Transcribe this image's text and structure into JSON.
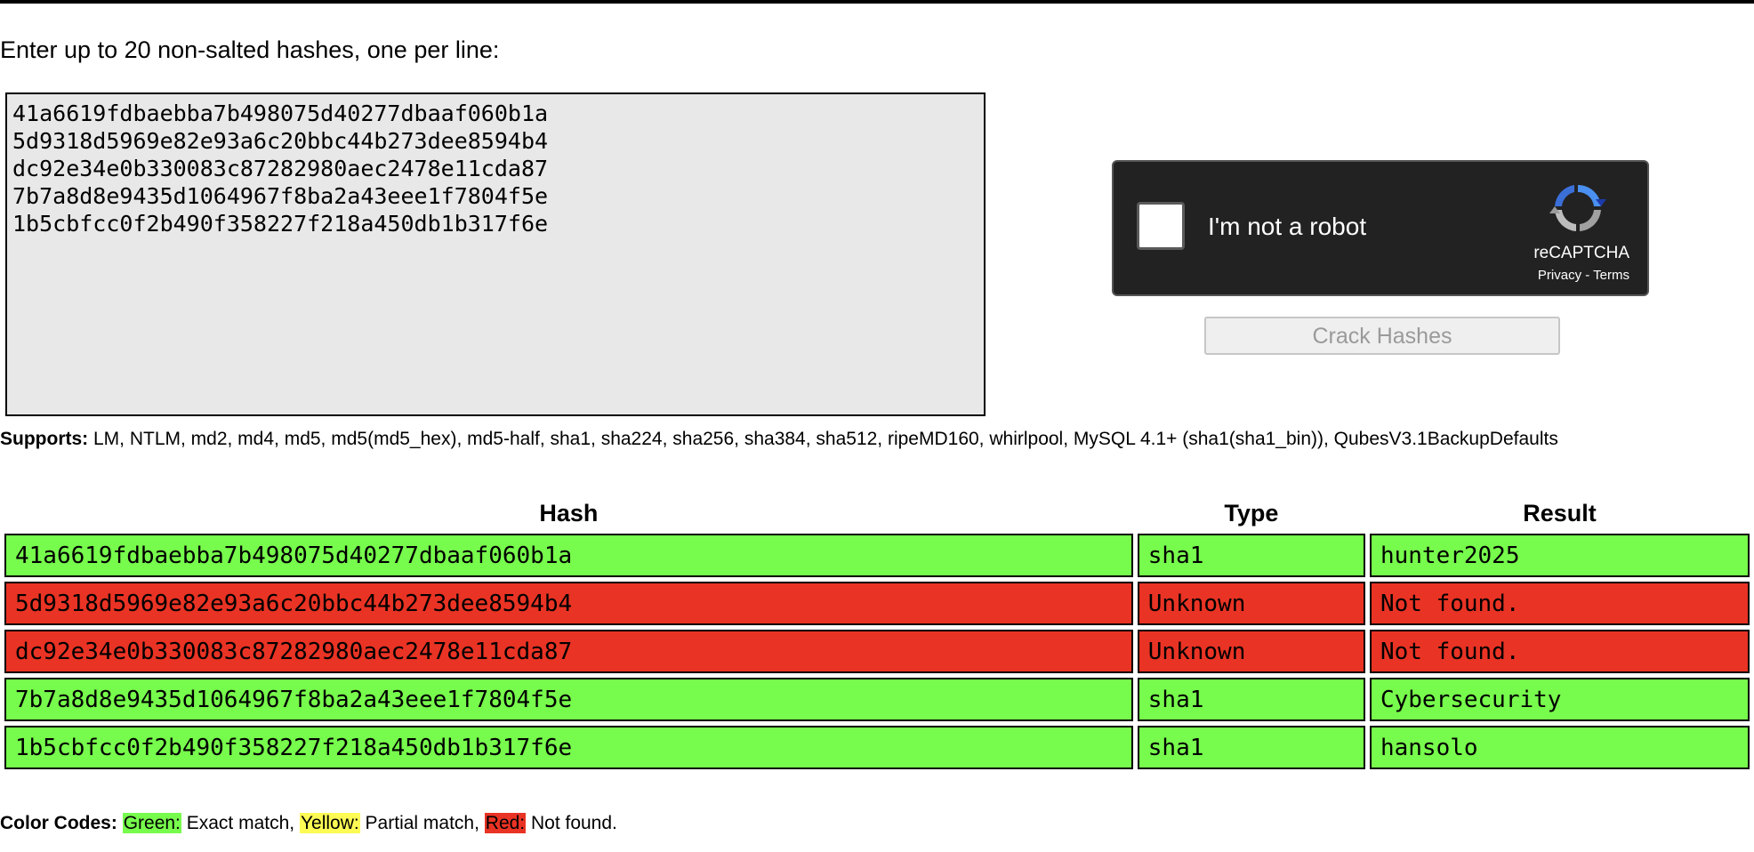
{
  "intro": "Enter up to 20 non-salted hashes, one per line:",
  "hash_input": {
    "value": "41a6619fdbaebba7b498075d40277dbaaf060b1a\n5d9318d5969e82e93a6c20bbc44b273dee8594b4\ndc92e34e0b330083c87282980aec2478e11cda87\n7b7a8d8e9435d1064967f8ba2a43eee1f7804f5e\n1b5cbfcc0f2b490f358227f218a450db1b317f6e"
  },
  "captcha": {
    "label": "I'm not a robot",
    "brand": "reCAPTCHA",
    "privacy": "Privacy",
    "separator": " - ",
    "terms": "Terms",
    "logo_icon": "recaptcha-logo-icon"
  },
  "crack_button": "Crack Hashes",
  "supports": {
    "label": "Supports:",
    "text": " LM, NTLM, md2, md4, md5, md5(md5_hex), md5-half, sha1, sha224, sha256, sha384, sha512, ripeMD160, whirlpool, MySQL 4.1+ (sha1(sha1_bin)), QubesV3.1BackupDefaults"
  },
  "table": {
    "headers": [
      "Hash",
      "Type",
      "Result"
    ],
    "rows": [
      {
        "hash": "41a6619fdbaebba7b498075d40277dbaaf060b1a",
        "type": "sha1",
        "result": "hunter2025",
        "status": "green"
      },
      {
        "hash": "5d9318d5969e82e93a6c20bbc44b273dee8594b4",
        "type": "Unknown",
        "result": "Not found.",
        "status": "red"
      },
      {
        "hash": "dc92e34e0b330083c87282980aec2478e11cda87",
        "type": "Unknown",
        "result": "Not found.",
        "status": "red"
      },
      {
        "hash": "7b7a8d8e9435d1064967f8ba2a43eee1f7804f5e",
        "type": "sha1",
        "result": "Cybersecurity",
        "status": "green"
      },
      {
        "hash": "1b5cbfcc0f2b490f358227f218a450db1b317f6e",
        "type": "sha1",
        "result": "hansolo",
        "status": "green"
      }
    ]
  },
  "legend": {
    "label": "Color Codes:",
    "green_label": "Green:",
    "green_text": " Exact match, ",
    "yellow_label": "Yellow:",
    "yellow_text": " Partial match, ",
    "red_label": "Red:",
    "red_text": " Not found."
  },
  "colors": {
    "green": "#77fb4c",
    "yellow": "#fdfb54",
    "red": "#e93324",
    "captcha_bg": "#222222",
    "textarea_bg": "#e8e8e8"
  }
}
